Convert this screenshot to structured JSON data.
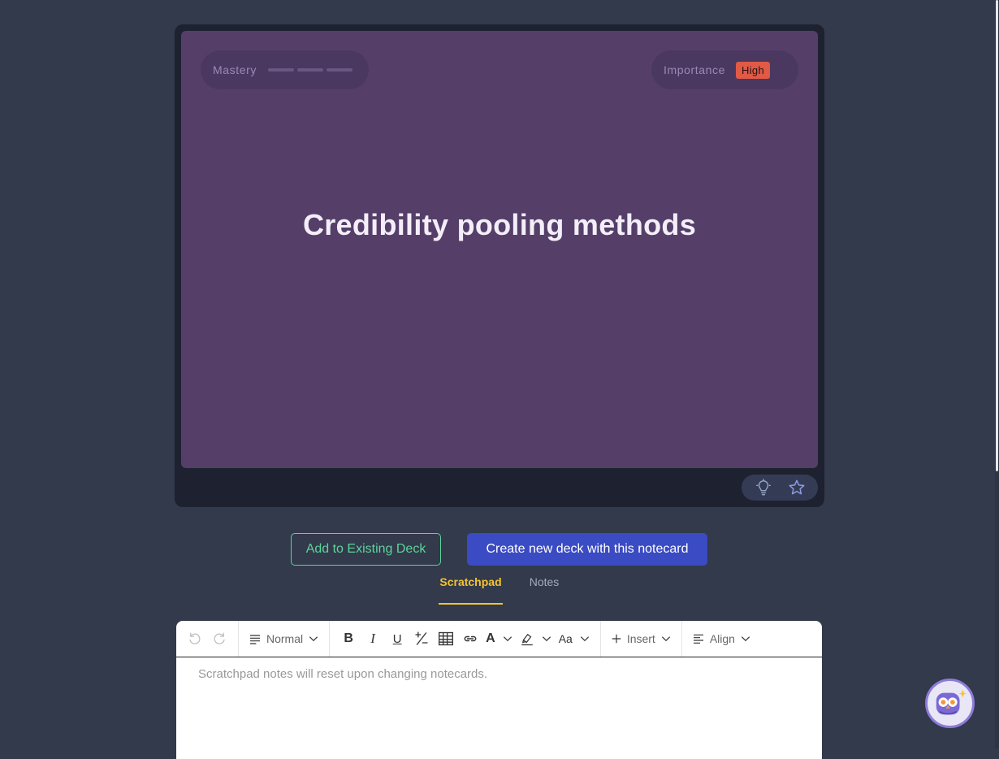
{
  "card": {
    "mastery_label": "Mastery",
    "mastery_level": 0,
    "mastery_segments": 3,
    "importance_label": "Importance",
    "importance_value": "High",
    "title": "Credibility pooling methods"
  },
  "actions": {
    "add_existing": "Add to Existing Deck",
    "create_new": "Create new deck with this notecard"
  },
  "tabs": {
    "scratchpad": "Scratchpad",
    "notes": "Notes"
  },
  "editor": {
    "block_type": "Normal",
    "bold": "B",
    "italic": "I",
    "underline": "U",
    "font_color": "A",
    "font_size": "Aa",
    "insert": "Insert",
    "align": "Align",
    "placeholder": "Scratchpad notes will reset upon changing notecards."
  },
  "colors": {
    "page_bg": "#323a4b",
    "card_face": "#553f69",
    "importance_high": "#e05a46",
    "accent_green": "#5fd39a",
    "accent_blue": "#3a4bc3",
    "tab_active": "#f4c430"
  }
}
